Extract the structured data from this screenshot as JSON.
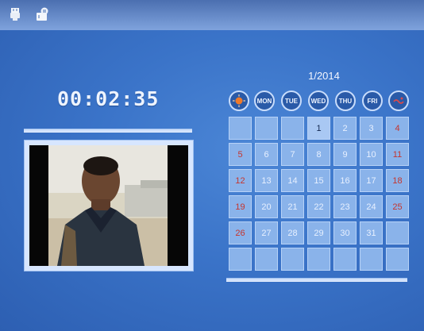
{
  "top_bar": {
    "icons": [
      "usb-icon",
      "memory-card-icon"
    ]
  },
  "clock": {
    "time": "00:02:35"
  },
  "calendar": {
    "month_year": "1/2014",
    "weekdays": [
      "",
      "MON",
      "TUE",
      "WED",
      "THU",
      "FRI",
      ""
    ],
    "weekday_icons": [
      "sun-icon",
      "",
      "",
      "",
      "",
      "",
      "saturday-icon"
    ],
    "rows": [
      [
        "",
        "",
        "",
        "1",
        "2",
        "3",
        "4"
      ],
      [
        "5",
        "6",
        "7",
        "8",
        "9",
        "10",
        "11"
      ],
      [
        "12",
        "13",
        "14",
        "15",
        "16",
        "17",
        "18"
      ],
      [
        "19",
        "20",
        "21",
        "22",
        "23",
        "24",
        "25"
      ],
      [
        "26",
        "27",
        "28",
        "29",
        "30",
        "31",
        ""
      ],
      [
        "",
        "",
        "",
        "",
        "",
        "",
        ""
      ]
    ],
    "today": "1",
    "weekend_color": "#c5352e"
  }
}
